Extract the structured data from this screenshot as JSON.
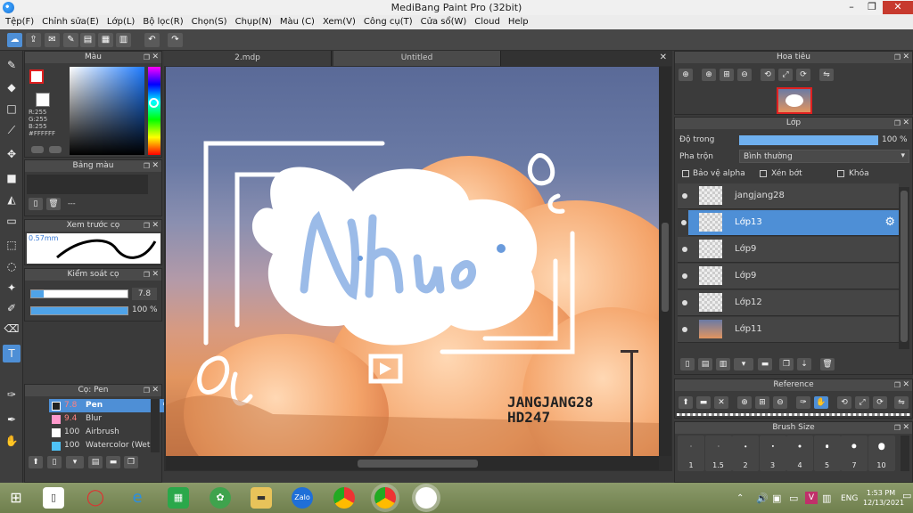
{
  "window": {
    "title": "MediBang Paint Pro (32bit)",
    "min": "–",
    "max": "❐",
    "close": "✕"
  },
  "menu": [
    "Tệp(F)",
    "Chỉnh sửa(E)",
    "Lớp(L)",
    "Bộ lọc(R)",
    "Chọn(S)",
    "Chụp(N)",
    "Màu (C)",
    "Xem(V)",
    "Công cụ(T)",
    "Cửa sổ(W)",
    "Cloud",
    "Help"
  ],
  "tabs": [
    "2.mdp",
    "Untitled"
  ],
  "color_panel": {
    "title": "Màu",
    "r": "R:255",
    "g": "G:255",
    "b": "B:255",
    "hex": "#FFFFFF"
  },
  "palette_panel": {
    "title": "Bảng màu",
    "empty": "---"
  },
  "brush_preview": {
    "title": "Xem trước cọ",
    "size": "0.57mm"
  },
  "brush_control": {
    "title": "Kiểm soát cọ",
    "size_value": "7.8",
    "opacity_value": "100 %",
    "opacity": 1.0
  },
  "brush_list": {
    "title": "Cọ: Pen",
    "items": [
      {
        "size": "7.8",
        "name": "Pen",
        "color": "#ffffff",
        "selected": true
      },
      {
        "size": "9.4",
        "name": "Blur",
        "color": "#ff99cc"
      },
      {
        "size": "100",
        "name": "Airbrush",
        "color": "#ffffff"
      },
      {
        "size": "100",
        "name": "Watercolor (Wet)",
        "color": "#4fc3f7"
      }
    ]
  },
  "navigator": {
    "title": "Hoa tiêu"
  },
  "layers_panel": {
    "title": "Lớp",
    "opacity_label": "Độ trong",
    "opacity_value": "100 %",
    "opacity": 1.0,
    "blend_label": "Pha trộn",
    "blend_value": "Bình thường",
    "protect_alpha": "Bảo vệ alpha",
    "clipping": "Xén bớt",
    "lock": "Khóa",
    "layers": [
      {
        "name": "jangjang28",
        "selected": false
      },
      {
        "name": "Lớp13",
        "selected": true
      },
      {
        "name": "Lớp9",
        "selected": false
      },
      {
        "name": "Lớp9",
        "selected": false
      },
      {
        "name": "Lớp12",
        "selected": false
      },
      {
        "name": "Lớp11",
        "selected": false
      }
    ]
  },
  "reference": {
    "title": "Reference"
  },
  "brush_size": {
    "title": "Brush Size",
    "sizes": [
      "1",
      "1.5",
      "2",
      "3",
      "4",
      "5",
      "7",
      "10"
    ]
  },
  "artwork": {
    "signature_line1": "JANGJANG28",
    "signature_line2": "HD247"
  },
  "taskbar": {
    "lang": "ENG",
    "time": "1:53 PM",
    "date": "12/13/2021",
    "zalo": "Zalo"
  },
  "colors": {
    "accent": "#4e8fd6",
    "panel": "#3b3b3b",
    "brush_selected": "#4e8fd6",
    "lettering_blue": "#8fb4e8"
  }
}
